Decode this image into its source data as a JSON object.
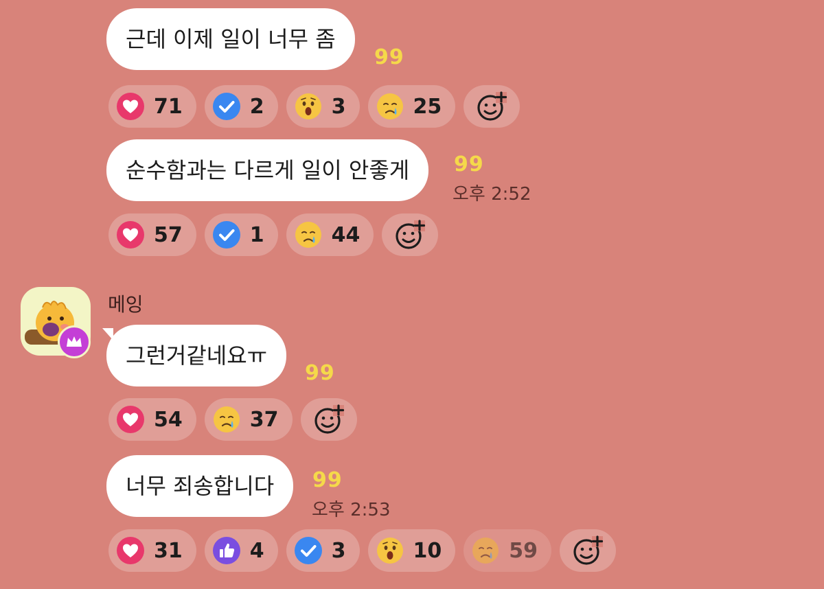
{
  "colors": {
    "background": "#d8837a",
    "bubble": "#ffffff",
    "unread": "#f5d94a",
    "heart": "#e8386b",
    "check": "#3a87f0",
    "like": "#7a4ee0",
    "crown_badge": "#c43fd6"
  },
  "messages": [
    {
      "text": "근데 이제 일이 너무 좀",
      "unread": "99",
      "time": "",
      "reactions": [
        {
          "icon": "heart-icon",
          "count": "71"
        },
        {
          "icon": "check-icon",
          "count": "2"
        },
        {
          "icon": "surprised-face-icon",
          "count": "3"
        },
        {
          "icon": "sad-face-icon",
          "count": "25"
        }
      ]
    },
    {
      "text": "순수함과는 다르게 일이 안좋게",
      "unread": "99",
      "time": "오후 2:52",
      "reactions": [
        {
          "icon": "heart-icon",
          "count": "57"
        },
        {
          "icon": "check-icon",
          "count": "1"
        },
        {
          "icon": "sad-face-icon",
          "count": "44"
        }
      ]
    },
    {
      "sender": "메잉",
      "text": "그런거같네요ㅠ",
      "unread": "99",
      "time": "",
      "reactions": [
        {
          "icon": "heart-icon",
          "count": "54"
        },
        {
          "icon": "sad-face-icon",
          "count": "37"
        }
      ]
    },
    {
      "text": "너무 죄송합니다",
      "unread": "99",
      "time": "오후 2:53",
      "reactions": [
        {
          "icon": "heart-icon",
          "count": "31"
        },
        {
          "icon": "thumbs-up-icon",
          "count": "4"
        },
        {
          "icon": "check-icon",
          "count": "3"
        },
        {
          "icon": "surprised-face-icon",
          "count": "10"
        },
        {
          "icon": "sad-face-icon",
          "count": "59"
        }
      ]
    }
  ]
}
